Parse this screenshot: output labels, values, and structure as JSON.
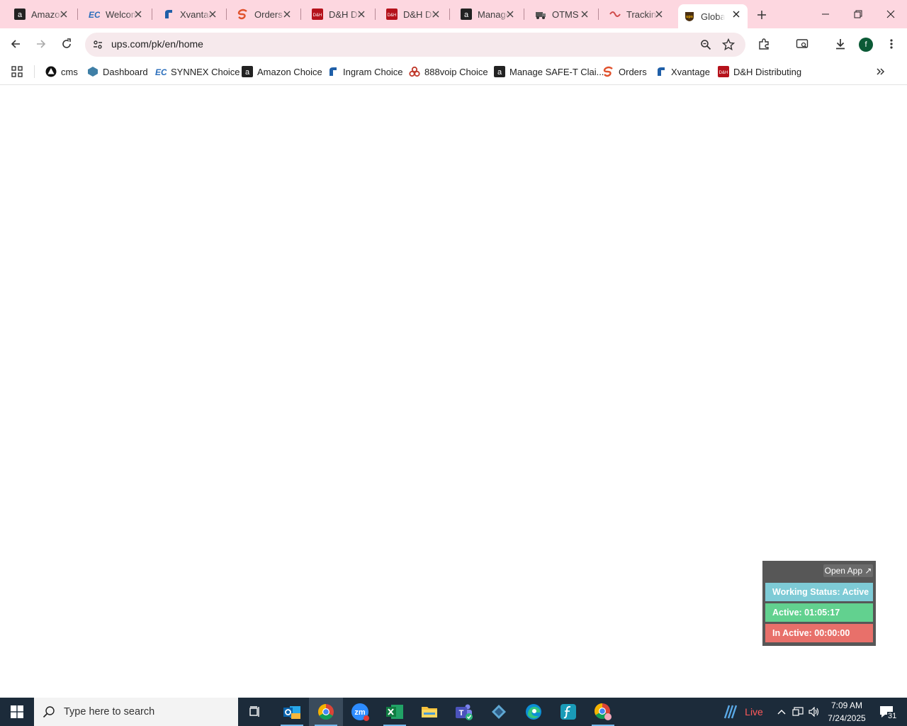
{
  "tabs": [
    {
      "title": "Amazon",
      "icon": "amazon-icon"
    },
    {
      "title": "Welcome",
      "icon": "ec-icon"
    },
    {
      "title": "Xvantage",
      "icon": "xvantage-icon"
    },
    {
      "title": "Orders",
      "icon": "orders-icon"
    },
    {
      "title": "D&H Distributing",
      "icon": "dh-icon"
    },
    {
      "title": "D&H Distributing",
      "icon": "dh-icon"
    },
    {
      "title": "Manage",
      "icon": "amazon-icon"
    },
    {
      "title": "OTMS",
      "icon": "otms-icon"
    },
    {
      "title": "Tracking",
      "icon": "tracking-icon"
    },
    {
      "title": "Global",
      "icon": "ups-icon",
      "active": true
    }
  ],
  "address": {
    "url": "ups.com/pk/en/home"
  },
  "profile": {
    "initial": "f"
  },
  "bookmarks": [
    {
      "label": "cms",
      "icon": "cms-icon"
    },
    {
      "label": "Dashboard",
      "icon": "dashboard-icon"
    },
    {
      "label": "SYNNEX Choice",
      "icon": "ec-icon"
    },
    {
      "label": "Amazon Choice",
      "icon": "amazon-icon"
    },
    {
      "label": "Ingram Choice",
      "icon": "xvantage-icon"
    },
    {
      "label": "888voip Choice",
      "icon": "voip-icon"
    },
    {
      "label": "Manage SAFE-T Clai...",
      "icon": "amazon-icon"
    },
    {
      "label": "Orders",
      "icon": "orders-icon"
    },
    {
      "label": "Xvantage",
      "icon": "xvantage-icon"
    },
    {
      "label": "D&H Distributing",
      "icon": "dh-icon"
    }
  ],
  "widget": {
    "open_app": "Open App ↗",
    "status": "Working Status: Active",
    "active": "Active: 01:05:17",
    "inactive": "In Active: 00:00:00",
    "colors": {
      "status": "#7ecbd6",
      "active": "#62d18f",
      "inactive": "#e8706a"
    }
  },
  "taskbar": {
    "search_placeholder": "Type here to search",
    "weather": "Live",
    "time": "7:09 AM",
    "date": "7/24/2025",
    "notifications": "31"
  }
}
